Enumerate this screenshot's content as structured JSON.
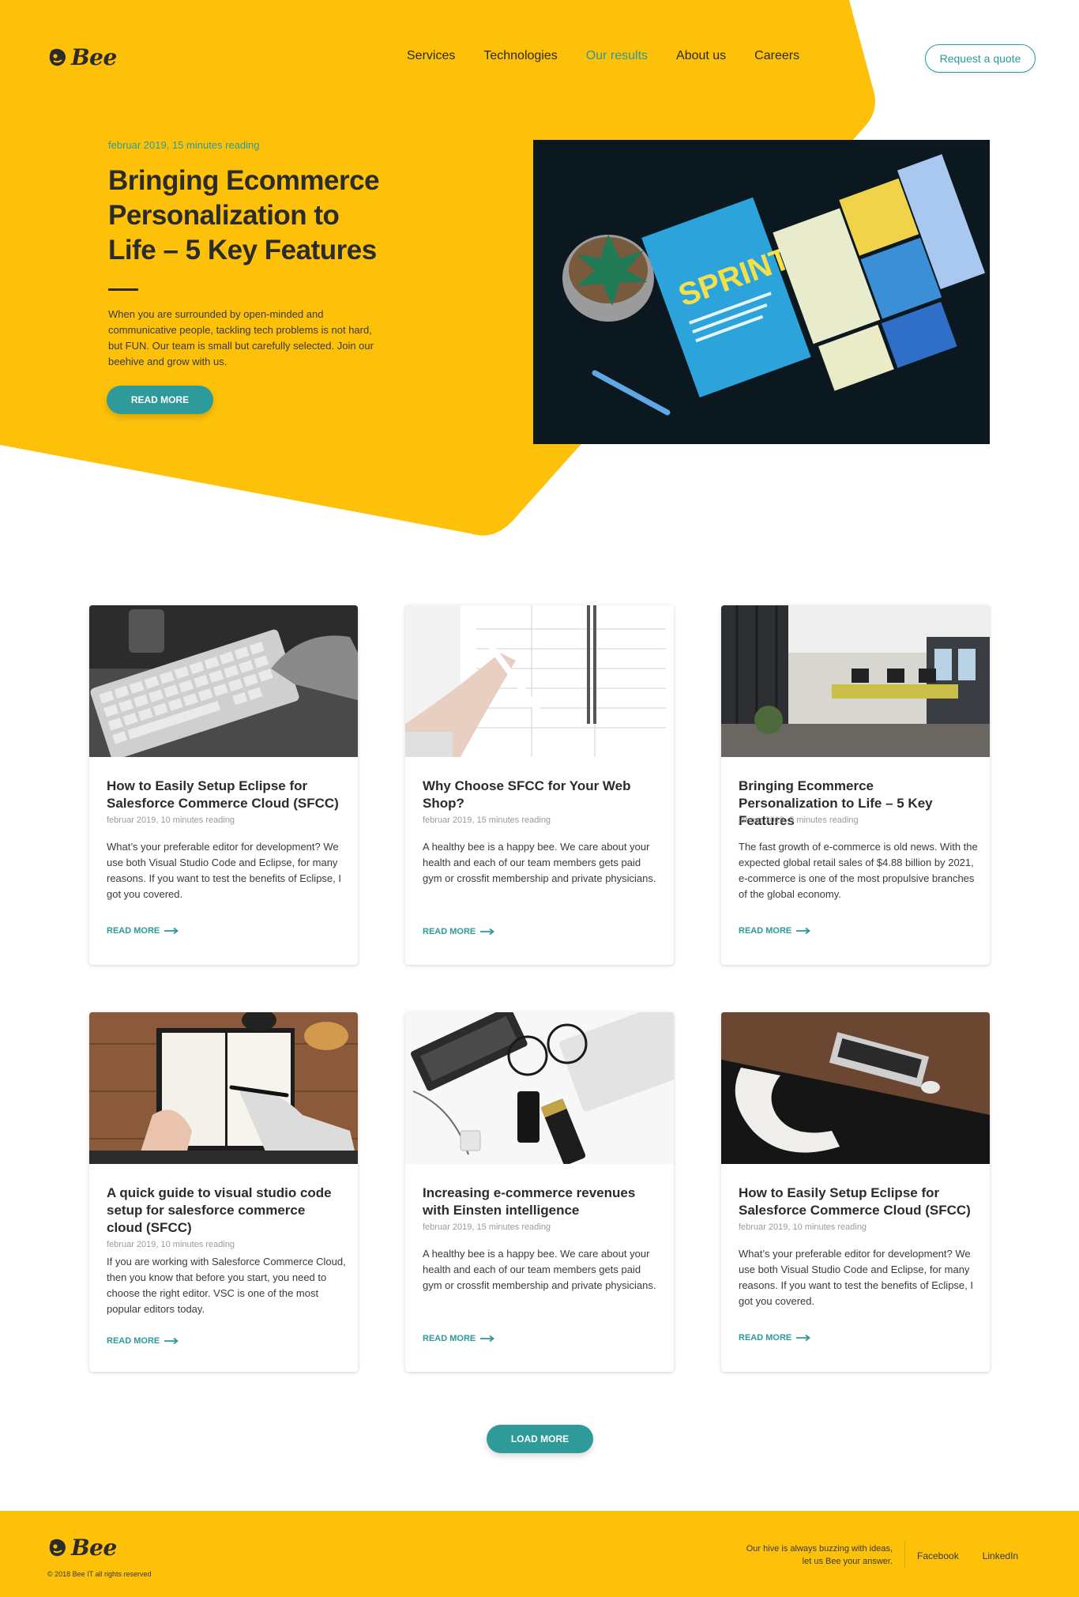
{
  "brand": {
    "name": "Bee",
    "accent": "#2e9a9a",
    "yellow": "#fdc10a"
  },
  "nav": {
    "items": [
      {
        "label": "Services"
      },
      {
        "label": "Technologies"
      },
      {
        "label": "Our results",
        "active": true
      },
      {
        "label": "About us"
      },
      {
        "label": "Careers"
      }
    ],
    "quote_label": "Request a quote"
  },
  "hero": {
    "meta": "februar 2019, 15 minutes reading",
    "title": "Bringing Ecommerce Personalization to Life – 5 Key Features",
    "body": "When you are surrounded by open-minded and communicative people, tackling tech problems is not hard, but FUN. Our team is small but carefully selected. Join our beehive and grow with us.",
    "button": "READ MORE",
    "image_book_title": "SPRINT"
  },
  "cards": [
    {
      "title": "How to Easily Setup Eclipse for Salesforce Commerce Cloud (SFCC)",
      "meta": "februar 2019, 10 minutes reading",
      "body": "What’s your preferable editor for development? We use both Visual Studio Code and Eclipse, for many reasons. If you want to test the benefits of Eclipse, I got you covered.",
      "more": "READ MORE",
      "image": "keyboard-photo"
    },
    {
      "title": "Why Choose SFCC for Your Web Shop?",
      "meta": "februar 2019, 15 minutes reading",
      "body": "A healthy bee is a happy bee. We care about your health and each of our team members gets paid gym or crossfit membership and private physicians.",
      "more": "READ MORE",
      "image": "planner-photo"
    },
    {
      "title": "Bringing Ecommerce Personalization to Life – 5 Key Features",
      "meta": "januar 2019, 5 minutes reading",
      "body": "The fast growth of e-commerce is old news. With the expected global retail sales of $4.88 billion by 2021, e-commerce is one of the most propulsive branches of the global economy.",
      "more": "READ MORE",
      "image": "office-photo"
    },
    {
      "title": "A quick guide to visual studio code setup for salesforce commerce cloud (SFCC)",
      "meta": "februar 2019, 10 minutes reading",
      "body": "If you are working with Salesforce Commerce Cloud, then you know that before you start, you need to choose the right editor. VSC is one of the most popular editors today.",
      "more": "READ MORE",
      "image": "notebook-photo"
    },
    {
      "title": "Increasing e-commerce revenues with Einsten intelligence",
      "meta": "februar 2019, 15 minutes reading",
      "body": "A healthy bee is a happy bee. We care about your health and each of our team members gets paid gym or crossfit membership and private physicians.",
      "more": "READ MORE",
      "image": "desk-items-photo"
    },
    {
      "title": "How to Easily Setup Eclipse for Salesforce Commerce Cloud (SFCC)",
      "meta": "februar 2019, 10 minutes reading",
      "body": "What’s your preferable editor for development? We use both Visual Studio Code and Eclipse, for many reasons. If you want to test the benefits of Eclipse, I got you covered.",
      "more": "READ MORE",
      "image": "laptop-photo"
    }
  ],
  "load_more": "LOAD MORE",
  "footer": {
    "copyright": "© 2018 Bee IT all rights reserved",
    "tagline_1": "Our hive is always buzzing with ideas,",
    "tagline_2": "let us Bee your answer.",
    "facebook": "Facebook",
    "linkedin": "LinkedIn"
  }
}
